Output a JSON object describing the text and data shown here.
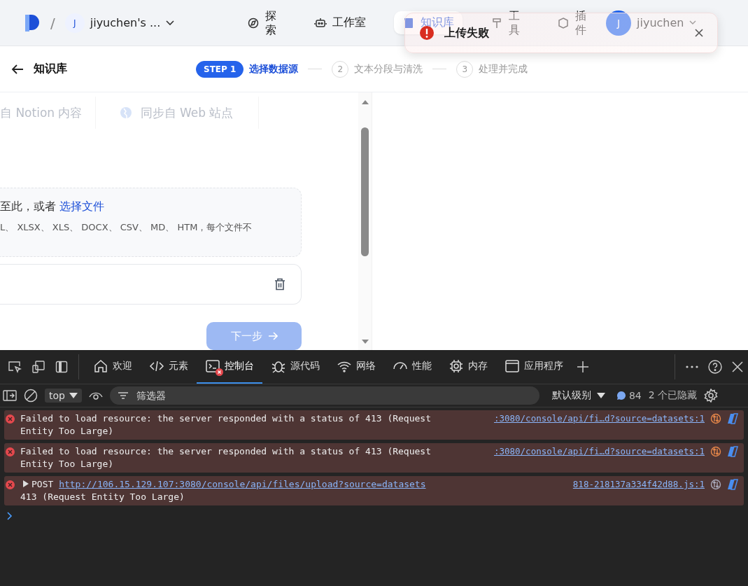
{
  "header": {
    "separator": "/",
    "workspace_avatar": "J",
    "workspace": "jiyuchen's ...",
    "nav": [
      {
        "label": "探索",
        "selected": false
      },
      {
        "label": "工作室",
        "selected": false
      },
      {
        "label": "知识库",
        "selected": true
      },
      {
        "label": "工具",
        "selected": false
      },
      {
        "label": "插件",
        "selected": false
      }
    ],
    "user_avatar": "J",
    "user": "jiyuchen"
  },
  "toast": {
    "kind": "error",
    "message": "上传失败"
  },
  "stepbar": {
    "back_label": "知识库",
    "steps": [
      {
        "badge": "STEP 1",
        "label": "选择数据源",
        "selected": true
      },
      {
        "badge": "2",
        "label": "文本分段与清洗",
        "selected": false
      },
      {
        "badge": "3",
        "label": "处理并完成",
        "selected": false
      }
    ]
  },
  "sources": [
    {
      "label": "自 Notion 内容"
    },
    {
      "label": "同步自 Web 站点"
    }
  ],
  "dropzone": {
    "prompt": "至此，或者 ",
    "link": "选择文件",
    "hint": "L、 XLSX、 XLS、 DOCX、 CSV、 MD、 HTM，每个文件不"
  },
  "next_button": {
    "label": "下一步",
    "disabled": true
  },
  "devtools": {
    "tabs": [
      {
        "label": "欢迎",
        "selected": false,
        "error_badge": false
      },
      {
        "label": "元素",
        "selected": false,
        "error_badge": false
      },
      {
        "label": "控制台",
        "selected": true,
        "error_badge": true
      },
      {
        "label": "源代码",
        "selected": false,
        "error_badge": false
      },
      {
        "label": "网络",
        "selected": false,
        "error_badge": false
      },
      {
        "label": "性能",
        "selected": false,
        "error_badge": false
      },
      {
        "label": "内存",
        "selected": false,
        "error_badge": false
      },
      {
        "label": "应用程序",
        "selected": false,
        "error_badge": false
      }
    ],
    "context": "top",
    "filter_placeholder": "筛选器",
    "level": "默认级别",
    "message_count": "84",
    "hidden": "2 个已隐藏",
    "messages": [
      {
        "kind": "error",
        "text": "Failed to load resource: the server responded with a status of 413 (Request Entity Too Large)",
        "source": ":3080/console/api/fi…d?source=datasets:1"
      },
      {
        "kind": "error",
        "text": "Failed to load resource: the server responded with a status of 413 (Request Entity Too Large)",
        "source": ":3080/console/api/fi…d?source=datasets:1"
      },
      {
        "kind": "request",
        "method": "POST",
        "url": "http://106.15.129.107:3080/console/api/files/upload?source=datasets",
        "text": " 413 (Request Entity Too Large)",
        "source": "818-218137a334f42d88.js:1"
      }
    ]
  }
}
